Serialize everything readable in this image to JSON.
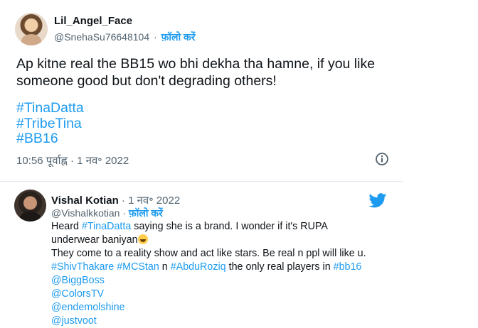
{
  "tweet1": {
    "display_name": "Lil_Angel_Face",
    "handle": "@SnehaSu76648104",
    "separator": "·",
    "follow_label": "फ़ॉलो करें",
    "text_line1": "Ap kitne real the BB15 wo bhi dekha tha hamne, if you like",
    "text_line2": "someone good but don't degrading others!",
    "hashtags": [
      "#TinaDatta",
      "#TribeTina",
      "#BB16"
    ],
    "timestamp": "10:56 पूर्वाह्न · 1 नव॰ 2022"
  },
  "tweet2": {
    "display_name": "Vishal Kotian",
    "date": " · 1 नव॰ 2022",
    "handle": "@Vishalkkotian",
    "separator": "·",
    "follow_label": "फ़ॉलो करें",
    "l1a": "Heard ",
    "l1b": "#TinaDatta",
    "l1c": " saying she is a brand. I wonder if it's RUPA",
    "l2": "underwear baniyan",
    "l3": "They come to a reality show and act like stars. Be real n ppl will like u.",
    "l4a": "#ShivThakare",
    "l4b": " ",
    "l4c": "#MCStan",
    "l4d": " n ",
    "l4e": "#AbduRoziq",
    "l4f": " the only real players in ",
    "l4g": "#bb16",
    "mentions": [
      "@BiggBoss",
      "@ColorsTV",
      "@endemolshine",
      "@justvoot"
    ]
  },
  "colors": {
    "accent": "#1d9bf0",
    "muted": "#536471",
    "text": "#0f1419"
  },
  "icons": [
    "info-icon",
    "twitter-bird-icon",
    "rofl-emoji"
  ]
}
